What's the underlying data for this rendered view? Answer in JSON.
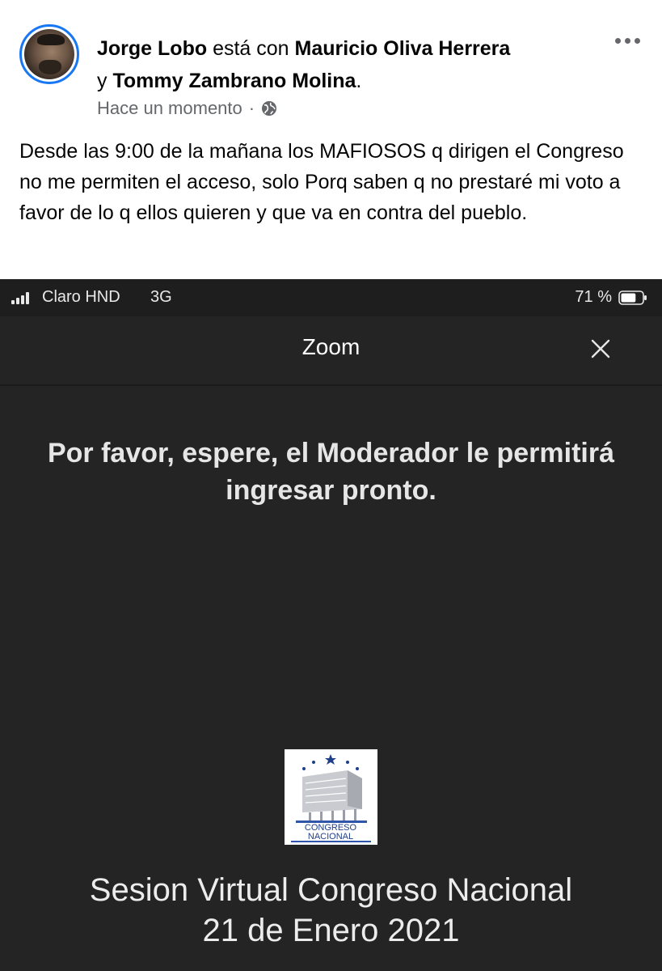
{
  "post": {
    "author": "Jorge Lobo",
    "connector": "está con",
    "tagged_1": "Mauricio Oliva Herrera",
    "joiner": "y",
    "tagged_2": "Tommy Zambrano Molina",
    "period": ".",
    "timestamp": "Hace un momento",
    "separator": "·",
    "privacy_icon": "globe-icon",
    "menu_icon": "more-horizontal-icon",
    "text": "Desde las 9:00 de la mañana los MAFIOSOS q dirigen el Congreso no me permiten el acceso, solo Porq saben q no prestaré mi voto a favor de lo q ellos quieren y que va en contra del pueblo.",
    "accent_color": "#1877f2"
  },
  "screenshot": {
    "status_bar": {
      "carrier": "Claro HND",
      "network": "3G",
      "battery": "71 %",
      "battery_level": 0.71
    },
    "app_bar": {
      "title": "Zoom",
      "close_icon": "close-icon"
    },
    "message": "Por favor, espere, el Moderador le permitirá ingresar pronto.",
    "logo": {
      "line1": "CONGRESO",
      "line2": "NACIONAL"
    },
    "session": {
      "title": "Sesion Virtual Congreso Nacional",
      "date": "21 de Enero 2021"
    },
    "background_color": "#242424"
  }
}
